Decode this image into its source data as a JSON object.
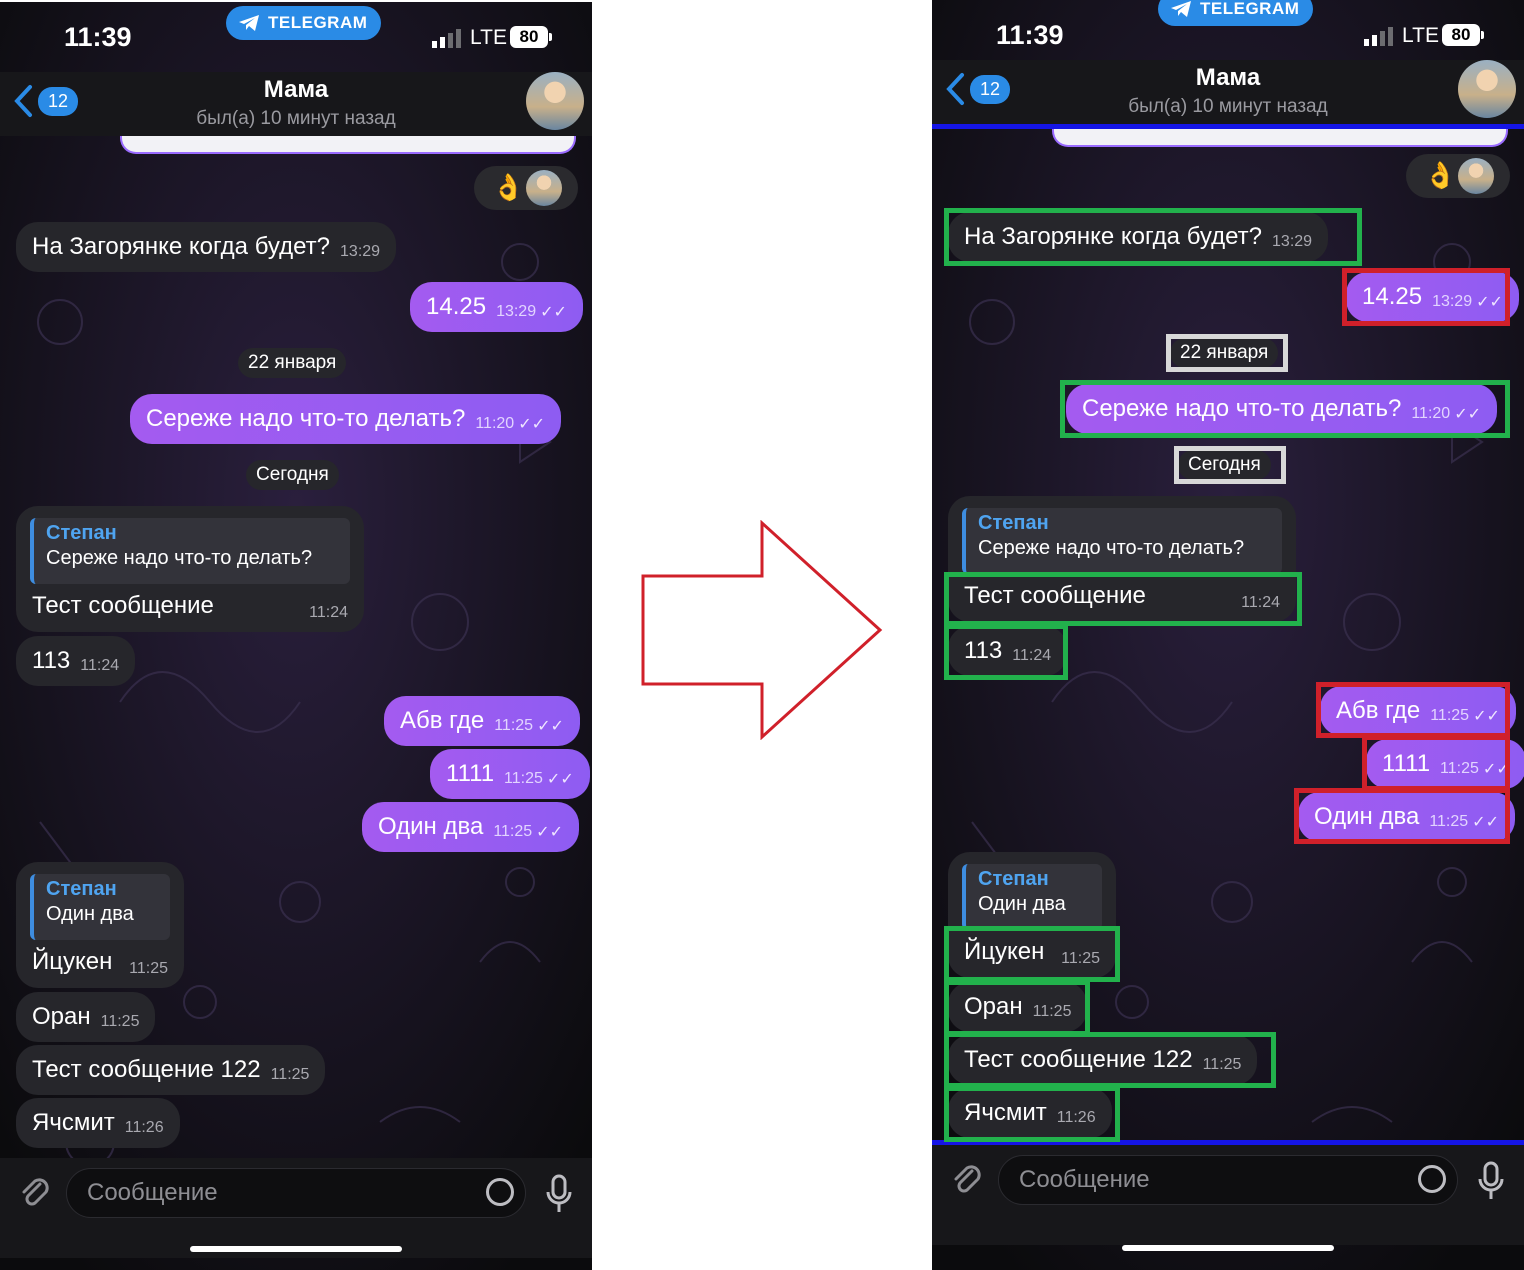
{
  "status": {
    "time": "11:39",
    "network": "LTE",
    "battery": "80",
    "app_pill": "TELEGRAM"
  },
  "header": {
    "back_count": "12",
    "title": "Мама",
    "subtitle": "был(а) 10 минут назад"
  },
  "chat": {
    "m1": {
      "text": "На Загорянке когда будет?",
      "time": "13:29"
    },
    "m2": {
      "text": "14.25",
      "time": "13:29"
    },
    "date1": "22 января",
    "m3": {
      "text": "Сереже надо что-то делать?",
      "time": "11:20"
    },
    "date2": "Сегодня",
    "r1": {
      "quote_name": "Степан",
      "quote_text": "Сереже надо что-то делать?",
      "text": "Тест сообщение",
      "time": "11:24"
    },
    "m4": {
      "text": "113",
      "time": "11:24"
    },
    "m5": {
      "text": "Абв где",
      "time": "11:25"
    },
    "m6": {
      "text": "1111",
      "time": "11:25"
    },
    "m7": {
      "text": "Один два",
      "time": "11:25"
    },
    "r2": {
      "quote_name": "Степан",
      "quote_text": "Один два",
      "text": "Йцукен",
      "time": "11:25"
    },
    "m8": {
      "text": "Оран",
      "time": "11:25"
    },
    "m9": {
      "text": "Тест сообщение 122",
      "time": "11:25"
    },
    "m10": {
      "text": "Ячсмит",
      "time": "11:26"
    }
  },
  "input": {
    "placeholder": "Сообщение"
  },
  "icons": [
    "telegram-plane-icon",
    "signal-icon",
    "back-chevron-icon",
    "avatar",
    "ok-hand-emoji",
    "paperclip-icon",
    "sticker-clock-icon",
    "microphone-icon",
    "read-checks-icon"
  ],
  "colors": {
    "accent": "#2a8be6",
    "outgoing_bubble": "#9a5cf2",
    "incoming_bubble": "#26262b",
    "highlight_green": "#22b14c",
    "highlight_red": "#d0202a",
    "highlight_blue": "#1515e6",
    "arrow": "#d0202a"
  }
}
